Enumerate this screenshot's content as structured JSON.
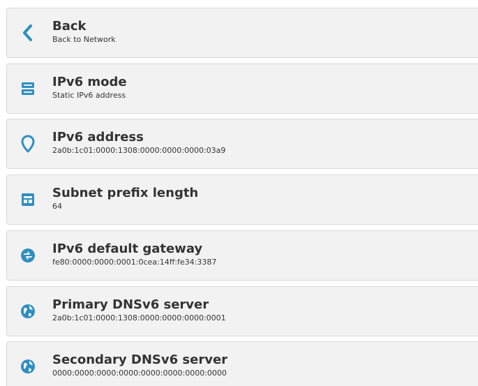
{
  "accent_color": "#2e8fc0",
  "items": [
    {
      "icon": "chevron-left-icon",
      "title": "Back",
      "subtitle": "Back to Network"
    },
    {
      "icon": "server-icon",
      "title": "IPv6 mode",
      "subtitle": "Static IPv6 address"
    },
    {
      "icon": "location-pin-icon",
      "title": "IPv6 address",
      "subtitle": "2a0b:1c01:0000:1308:0000:0000:0000:03a9"
    },
    {
      "icon": "subnet-icon",
      "title": "Subnet prefix length",
      "subtitle": "64"
    },
    {
      "icon": "gateway-icon",
      "title": "IPv6 default gateway",
      "subtitle": "fe80:0000:0000:0001:0cea:14ff:fe34:3387"
    },
    {
      "icon": "globe-icon",
      "title": "Primary DNSv6 server",
      "subtitle": "2a0b:1c01:0000:1308:0000:0000:0000:0001"
    },
    {
      "icon": "globe-icon",
      "title": "Secondary DNSv6 server",
      "subtitle": "0000:0000:0000:0000:0000:0000:0000:0000"
    }
  ]
}
